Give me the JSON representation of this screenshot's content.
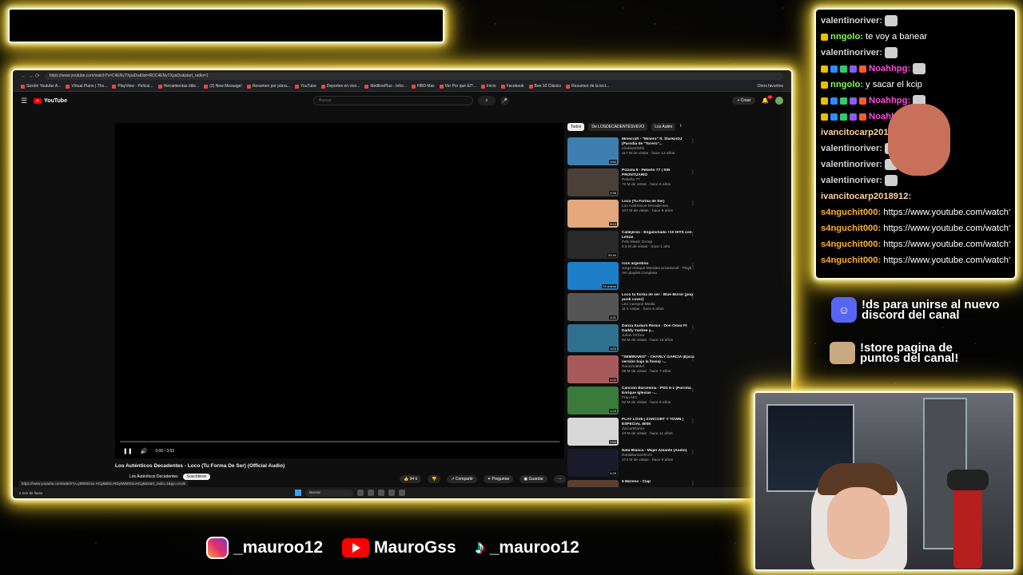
{
  "browser": {
    "url": "https://www.youtube.com/watch?v=C4ENyTXpaDo&list=RDC4ENyTXpaDo&start_radio=1",
    "bookmarks": [
      "Sesión Youtube A...",
      "Virtual Piano | The...",
      "PlayView - Películ...",
      "Herramientas útile...",
      "(2) New Message!",
      "Resumen por párra...",
      "YouTube",
      "Deportes en vivo...",
      "MedlinePlus - Infor...",
      "HBO Max",
      "Ver Por qué El?...",
      "Inicio",
      "Facebook",
      "Bee 10 Clásico",
      "Resumen de la lect..."
    ],
    "other_bookmarks": "Otros favoritos"
  },
  "youtube": {
    "logo_text": "YouTube",
    "search_placeholder": "Buscar",
    "create_label": "Crear",
    "notif_count": "9+",
    "player": {
      "time": "0:00 / 3:53"
    },
    "video_title": "Los Auténticos Decadentes - Loco (Tu Forma De Ser) (Official Audio)",
    "channel": "Los Auténticos Decadentes",
    "subscribe_label": "Suscribirse",
    "likes": "94 k",
    "share_label": "Compartir",
    "ask_label": "Preguntar",
    "save_label": "Guardar",
    "status_url": "https://www.youtube.com/watch?v=ytW50Gsu HCg8&list=RDytW50GsuHCg8&start_radio=1&pp=oAcB",
    "chips": [
      "Todos",
      "De LOSDECADENTESVEVO",
      "Los Autén"
    ],
    "related": [
      {
        "title": "Minecraft - \"Minero\" ft. StarkinDJ (Parodia de \"Torero\"...",
        "channel": "elrubiusOMG",
        "views": "117 M de vistas · hace 13 años",
        "duration": "3:54",
        "color": "#3f7fb0"
      },
      {
        "title": "Pizzola II - Pekeño 77 | SIN PRONTUARIO",
        "channel": "Pekeño 77",
        "views": "72 M de vistas · hace 6 años",
        "duration": "2:58",
        "color": "#4a4038"
      },
      {
        "title": "Loco (Tu Forma de Ser)",
        "channel": "Los Auténticos Decadentes",
        "views": "107 M de vistas · hace 8 años",
        "duration": "5:13",
        "color": "#e2a77a"
      },
      {
        "title": "Callejeros - Enganchado +10 HITS con Letras",
        "channel": "Pelo Music Group",
        "views": "5,5 M de vistas · hace 1 año",
        "duration": "53:40",
        "color": "#2a2a2a"
      },
      {
        "title": "rock argentino",
        "channel": "Jorge enrique Morales arzamendi · Playli...",
        "views": "Ver playlist completa",
        "duration": "74 videos",
        "color": "#1c7fc7"
      },
      {
        "title": "Loco tu forma de ser - Blue Mirror (pop punk cover)",
        "channel": "Leo Campos Media",
        "views": "11 k vistas · hace 9 años",
        "duration": "3:01",
        "color": "#555555"
      },
      {
        "title": "Danza Kuduro Remix - Don Omar Ft Daddy Yankee y...",
        "channel": "Julian Ochoa",
        "views": "92 M de vistas · hace 15 años",
        "duration": "3:53",
        "color": "#2f6f8f"
      },
      {
        "title": "\"SEMINARIS\" - CHARLY GARCÍA (Épica versión bajo la lluvia) -...",
        "channel": "RonozealMel",
        "views": "35 M de vistas · hace 7 años",
        "duration": "4:02",
        "color": "#a85a5a"
      },
      {
        "title": "Canción Barcelona - PSG 6-1 (Parodia Enrique Iglesias -...",
        "channel": "Fran MG",
        "views": "92 M de vistas · hace 8 años",
        "duration": "3:25",
        "color": "#3a7a3a"
      },
      {
        "title": "PLAY LOVE | ZARCORT Y TOWN | ESPECIAL 800K",
        "channel": "ZarcortRamo",
        "views": "10 M de vistas · hace 11 años",
        "duration": "2:53",
        "color": "#d8d8d8"
      },
      {
        "title": "Nata Blanca - Mujer Amante (Audio)",
        "channel": "RataBlancaVEVO",
        "views": "174 M de vistas · hace 9 años",
        "duration": "4:29",
        "color": "#1a1a2a"
      },
      {
        "title": "5 Moreno - Clap",
        "channel": "",
        "views": "",
        "duration": "",
        "color": "#5a4030"
      }
    ],
    "taskbar": {
      "weather": "2 mm de lluvia",
      "search": "Buscar"
    }
  },
  "chat": [
    {
      "user": "valentinoriver:",
      "color": "#d0d0d0",
      "badges": 0,
      "text": "",
      "emotes": [
        "cat"
      ]
    },
    {
      "user": "nngolo:",
      "color": "#7fff4a",
      "badges": 1,
      "text": "te voy a banear",
      "emotes": []
    },
    {
      "user": "valentinoriver:",
      "color": "#d0d0d0",
      "badges": 0,
      "text": "",
      "emotes": [
        "cat"
      ]
    },
    {
      "user": "Noahhpg:",
      "color": "#ff4ad8",
      "badges": 5,
      "text": "",
      "emotes": [
        "cat"
      ]
    },
    {
      "user": "nngolo:",
      "color": "#7fff4a",
      "badges": 1,
      "text": "y sacar el kcip",
      "emotes": []
    },
    {
      "user": "Noahhpg:",
      "color": "#ff4ad8",
      "badges": 5,
      "text": "",
      "emotes": [
        "cat"
      ]
    },
    {
      "user": "Noahhpg:",
      "color": "#ff4ad8",
      "badges": 5,
      "text": "",
      "emotes": [
        "cat"
      ]
    },
    {
      "user": "ivancitocarp2018912:",
      "color": "#ffd0a0",
      "badges": 0,
      "text": "",
      "emotes": [
        "face",
        "face",
        "face"
      ]
    },
    {
      "user": "valentinoriver:",
      "color": "#d0d0d0",
      "badges": 0,
      "text": "",
      "emotes": [
        "cat"
      ]
    },
    {
      "user": "valentinoriver:",
      "color": "#d0d0d0",
      "badges": 0,
      "text": "",
      "emotes": [
        "cat"
      ]
    },
    {
      "user": "valentinoriver:",
      "color": "#d0d0d0",
      "badges": 0,
      "text": "",
      "emotes": [
        "cat"
      ]
    },
    {
      "user": "ivancitocarp2018912:",
      "color": "#ffd0a0",
      "badges": 0,
      "text": "",
      "emotes": [
        "face",
        "face",
        "face"
      ]
    },
    {
      "user": "s4nguchit000:",
      "color": "#ffb02e",
      "badges": 0,
      "text": "https://www.youtube.com/watch?v=",
      "emotes": []
    },
    {
      "user": "s4nguchit000:",
      "color": "#ffb02e",
      "badges": 0,
      "text": "https://www.youtube.com/watch?v=",
      "emotes": []
    },
    {
      "user": "s4nguchit000:",
      "color": "#ffb02e",
      "badges": 0,
      "text": "https://www.youtube.com/watch?v=",
      "emotes": []
    },
    {
      "user": "s4nguchit000:",
      "color": "#ffb02e",
      "badges": 0,
      "text": "https://www.youtube.com/watch?v=",
      "emotes": []
    }
  ],
  "promos": {
    "discord": "!ds para unirse al nuevo discord del canal",
    "store": "!store pagina de puntos del canal!"
  },
  "socials": {
    "instagram": "_mauroo12",
    "youtube": "MauroGss",
    "tiktok": "_mauroo12"
  }
}
